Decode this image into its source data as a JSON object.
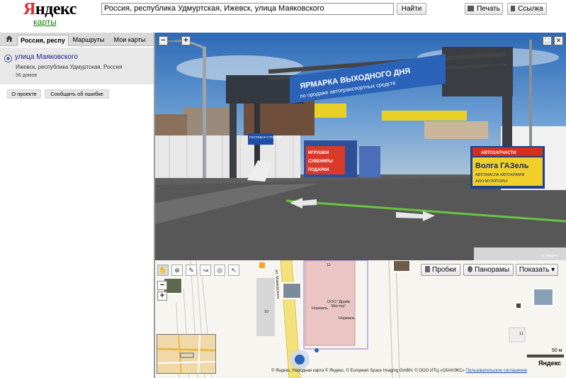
{
  "header": {
    "logo_ya": "Я",
    "logo_rest": "ндекс",
    "logo_sub": "карты",
    "search_value": "Россия, республика Удмуртская, Ижевск, улица Маяковского",
    "search_button": "Найти",
    "print_button": "Печать",
    "link_button": "Ссылка"
  },
  "sidebar": {
    "tabs": [
      {
        "label": "Россия, респу"
      },
      {
        "label": "Маршруты"
      },
      {
        "label": "Мои карты"
      }
    ],
    "result": {
      "title": "улица Маяковского",
      "address": "Ижевск, республика Удмуртская, Россия",
      "houses": "36 домов"
    },
    "buttons": {
      "about": "О проекте",
      "report": "Сообщить об ошибке"
    }
  },
  "panorama": {
    "arch_sign_1": "ЯРМАРКА ВЫХОДНОГО ДНЯ",
    "arch_sign_2": "по продаже автотранспортных средств",
    "booth_sign_1": "ИГРУШКИ",
    "booth_sign_2": "СУВЕНИРЫ",
    "booth_sign_3": "ПОДАРКИ",
    "guest_sign": "ГОСТЕВАЯ СТОЯНКА",
    "right_sign_1": "АВТОЗАПЧАСТИ",
    "right_sign_2": "Волга ГАЗель",
    "right_sign_3": "АВТОМАСЛА АВТОХИМИЯ",
    "right_sign_4": "АККУМУЛЯТОРЫ",
    "copyright": "© Яндекс"
  },
  "map": {
    "layers": {
      "traffic": "Пробки",
      "panoramas": "Панорамы",
      "show": "Показать ▾"
    },
    "labels": {
      "street": "ул. Маяковского",
      "building_11": "11",
      "building_10": "10",
      "building_11b": "11",
      "company": "ООО \"Драйв Мастер\"",
      "normal_1": "Нормаль",
      "normal_2": "Нормаль"
    },
    "scale_text": "50 м",
    "logo": "Яндекс",
    "copyright": "© Яндекс, Народная карта © Яндекс, © European Space Imaging GmBH, © ООО ИТЦ «СКАНЭКС»",
    "terms_link": "Пользовательское соглашение"
  },
  "colors": {
    "logo_red": "#e8262a",
    "logo_sub_green": "#0b7e0b",
    "banner_blue": "#2a63b8",
    "route_green": "#69c443"
  }
}
